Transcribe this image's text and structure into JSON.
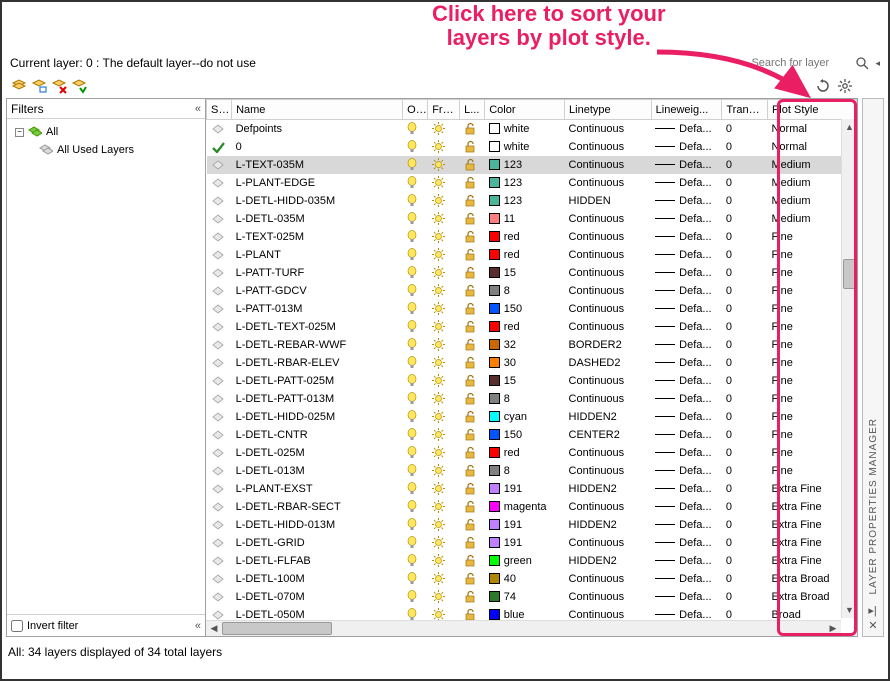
{
  "annotation": {
    "line1": "Click here to sort your",
    "line2": "layers by plot style."
  },
  "topbar": {
    "current": "Current layer: 0 : The default layer--do not use",
    "search_placeholder": "Search for layer"
  },
  "filters": {
    "title": "Filters",
    "tree": {
      "all": "All",
      "used": "All Used Layers"
    },
    "invert": "Invert filter"
  },
  "columns": {
    "status": "S...",
    "name": "Name",
    "on": "O...",
    "freeze": "Fre...",
    "lock": "L...",
    "color": "Color",
    "linetype": "Linetype",
    "lineweight": "Lineweig...",
    "trans": "Trans...",
    "plotstyle": "Plot Style"
  },
  "rows": [
    {
      "name": "Defpoints",
      "color_name": "white",
      "swatch": "#ffffff",
      "linetype": "Continuous",
      "lineweight": "Defa...",
      "trans": "0",
      "plotstyle": "Normal",
      "current": false
    },
    {
      "name": "0",
      "color_name": "white",
      "swatch": "#ffffff",
      "linetype": "Continuous",
      "lineweight": "Defa...",
      "trans": "0",
      "plotstyle": "Normal",
      "current": true
    },
    {
      "name": "L-TEXT-035M",
      "color_name": "123",
      "swatch": "#4bb59b",
      "linetype": "Continuous",
      "lineweight": "Defa...",
      "trans": "0",
      "plotstyle": "Medium",
      "selected": true
    },
    {
      "name": "L-PLANT-EDGE",
      "color_name": "123",
      "swatch": "#4bb59b",
      "linetype": "Continuous",
      "lineweight": "Defa...",
      "trans": "0",
      "plotstyle": "Medium"
    },
    {
      "name": "L-DETL-HIDD-035M",
      "color_name": "123",
      "swatch": "#4bb59b",
      "linetype": "HIDDEN",
      "lineweight": "Defa...",
      "trans": "0",
      "plotstyle": "Medium"
    },
    {
      "name": "L-DETL-035M",
      "color_name": "11",
      "swatch": "#ff7f7f",
      "linetype": "Continuous",
      "lineweight": "Defa...",
      "trans": "0",
      "plotstyle": "Medium"
    },
    {
      "name": "L-TEXT-025M",
      "color_name": "red",
      "swatch": "#ff0000",
      "linetype": "Continuous",
      "lineweight": "Defa...",
      "trans": "0",
      "plotstyle": "Fine"
    },
    {
      "name": "L-PLANT",
      "color_name": "red",
      "swatch": "#ff0000",
      "linetype": "Continuous",
      "lineweight": "Defa...",
      "trans": "0",
      "plotstyle": "Fine"
    },
    {
      "name": "L-PATT-TURF",
      "color_name": "15",
      "swatch": "#5a2d2d",
      "linetype": "Continuous",
      "lineweight": "Defa...",
      "trans": "0",
      "plotstyle": "Fine"
    },
    {
      "name": "L-PATT-GDCV",
      "color_name": "8",
      "swatch": "#808080",
      "linetype": "Continuous",
      "lineweight": "Defa...",
      "trans": "0",
      "plotstyle": "Fine"
    },
    {
      "name": "L-PATT-013M",
      "color_name": "150",
      "swatch": "#0055ff",
      "linetype": "Continuous",
      "lineweight": "Defa...",
      "trans": "0",
      "plotstyle": "Fine"
    },
    {
      "name": "L-DETL-TEXT-025M",
      "color_name": "red",
      "swatch": "#ff0000",
      "linetype": "Continuous",
      "lineweight": "Defa...",
      "trans": "0",
      "plotstyle": "Fine"
    },
    {
      "name": "L-DETL-REBAR-WWF",
      "color_name": "32",
      "swatch": "#cc6600",
      "linetype": "BORDER2",
      "lineweight": "Defa...",
      "trans": "0",
      "plotstyle": "Fine"
    },
    {
      "name": "L-DETL-RBAR-ELEV",
      "color_name": "30",
      "swatch": "#ff7f00",
      "linetype": "DASHED2",
      "lineweight": "Defa...",
      "trans": "0",
      "plotstyle": "Fine"
    },
    {
      "name": "L-DETL-PATT-025M",
      "color_name": "15",
      "swatch": "#5a2d2d",
      "linetype": "Continuous",
      "lineweight": "Defa...",
      "trans": "0",
      "plotstyle": "Fine"
    },
    {
      "name": "L-DETL-PATT-013M",
      "color_name": "8",
      "swatch": "#808080",
      "linetype": "Continuous",
      "lineweight": "Defa...",
      "trans": "0",
      "plotstyle": "Fine"
    },
    {
      "name": "L-DETL-HIDD-025M",
      "color_name": "cyan",
      "swatch": "#00ffff",
      "linetype": "HIDDEN2",
      "lineweight": "Defa...",
      "trans": "0",
      "plotstyle": "Fine"
    },
    {
      "name": "L-DETL-CNTR",
      "color_name": "150",
      "swatch": "#0055ff",
      "linetype": "CENTER2",
      "lineweight": "Defa...",
      "trans": "0",
      "plotstyle": "Fine"
    },
    {
      "name": "L-DETL-025M",
      "color_name": "red",
      "swatch": "#ff0000",
      "linetype": "Continuous",
      "lineweight": "Defa...",
      "trans": "0",
      "plotstyle": "Fine"
    },
    {
      "name": "L-DETL-013M",
      "color_name": "8",
      "swatch": "#808080",
      "linetype": "Continuous",
      "lineweight": "Defa...",
      "trans": "0",
      "plotstyle": "Fine"
    },
    {
      "name": "L-PLANT-EXST",
      "color_name": "191",
      "swatch": "#bf7fff",
      "linetype": "HIDDEN2",
      "lineweight": "Defa...",
      "trans": "0",
      "plotstyle": "Extra Fine"
    },
    {
      "name": "L-DETL-RBAR-SECT",
      "color_name": "magenta",
      "swatch": "#ff00ff",
      "linetype": "Continuous",
      "lineweight": "Defa...",
      "trans": "0",
      "plotstyle": "Extra Fine"
    },
    {
      "name": "L-DETL-HIDD-013M",
      "color_name": "191",
      "swatch": "#bf7fff",
      "linetype": "HIDDEN2",
      "lineweight": "Defa...",
      "trans": "0",
      "plotstyle": "Extra Fine"
    },
    {
      "name": "L-DETL-GRID",
      "color_name": "191",
      "swatch": "#bf7fff",
      "linetype": "Continuous",
      "lineweight": "Defa...",
      "trans": "0",
      "plotstyle": "Extra Fine"
    },
    {
      "name": "L-DETL-FLFAB",
      "color_name": "green",
      "swatch": "#00ff00",
      "linetype": "HIDDEN2",
      "lineweight": "Defa...",
      "trans": "0",
      "plotstyle": "Extra Fine"
    },
    {
      "name": "L-DETL-100M",
      "color_name": "40",
      "swatch": "#b38600",
      "linetype": "Continuous",
      "lineweight": "Defa...",
      "trans": "0",
      "plotstyle": "Extra Broad"
    },
    {
      "name": "L-DETL-070M",
      "color_name": "74",
      "swatch": "#2d7a2d",
      "linetype": "Continuous",
      "lineweight": "Defa...",
      "trans": "0",
      "plotstyle": "Extra Broad"
    },
    {
      "name": "L-DETL-050M",
      "color_name": "blue",
      "swatch": "#0000ff",
      "linetype": "Continuous",
      "lineweight": "Defa...",
      "trans": "0",
      "plotstyle": "Broad"
    }
  ],
  "status": "All: 34 layers displayed of 34 total layers",
  "sidetab": "LAYER PROPERTIES MANAGER"
}
